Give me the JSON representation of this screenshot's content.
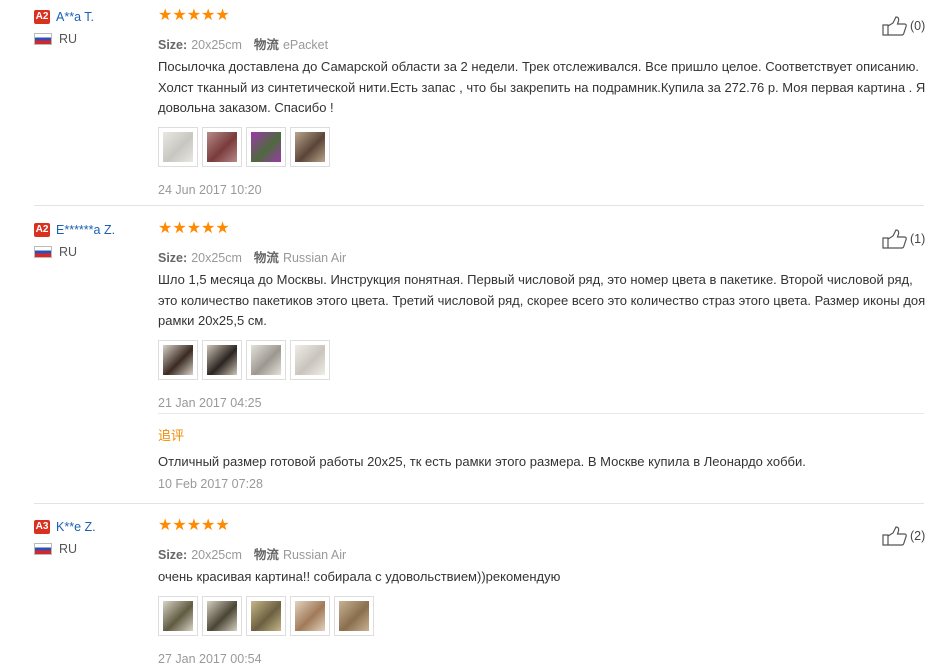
{
  "reviews": [
    {
      "badge": "A2",
      "name": "A**a T.",
      "country": "RU",
      "stars": "★★★★★",
      "size_label": "Size:",
      "size_value": "20x25cm",
      "ship_label": "物流",
      "ship_value": "ePacket",
      "text": "Посылочка доставлена до Самарской области за 2 недели. Трек отслеживался. Все пришло целое. Соответствует описанию. Холст тканный из синтетической нити.Есть запас , что бы закрепить на подрамник.Купила за 272.76 р. Моя первая картина . Я довольна заказом. Спасибо !",
      "date": "24 Jun 2017 10:20",
      "helpful": "(0)",
      "thumb_colors": [
        [
          "#c8c6c0",
          "#e9e7e2"
        ],
        [
          "#7a3b3b",
          "#b58a8a"
        ],
        [
          "#4e6a3e",
          "#9b3aa8"
        ],
        [
          "#5a4438",
          "#b9a58c"
        ]
      ]
    },
    {
      "badge": "A2",
      "name": "E******a Z.",
      "country": "RU",
      "stars": "★★★★★",
      "size_label": "Size:",
      "size_value": "20x25cm",
      "ship_label": "物流",
      "ship_value": "Russian Air",
      "text": "Шло 1,5 месяца до Москвы. Инструкция понятная. Первый числовой ряд, это номер цвета в пакетике. Второй числовой ряд, это количество пакетиков этого цвета. Третий числовой ряд, скорее всего это количество страз этого цвета. Размер иконы доя рамки 20x25,5 см.",
      "date": "21 Jan 2017 04:25",
      "helpful": "(1)",
      "append_title": "追评",
      "append_text": "Отличный размер готовой работы 20x25, тк есть рамки этого размера. В Москве купила в Леонардо хобби.",
      "append_date": "10 Feb 2017 07:28",
      "thumb_colors": [
        [
          "#3a2a22",
          "#d8d2c8"
        ],
        [
          "#2b2420",
          "#cfc6b8"
        ],
        [
          "#9c9890",
          "#e4e1dc"
        ],
        [
          "#c9c4bc",
          "#efece8"
        ]
      ]
    },
    {
      "badge": "A3",
      "name": "K**e Z.",
      "country": "RU",
      "stars": "★★★★★",
      "size_label": "Size:",
      "size_value": "20x25cm",
      "ship_label": "物流",
      "ship_value": "Russian Air",
      "text": "очень красивая картина!! собирала с удовольствием))рекомендую",
      "date": "27 Jan 2017 00:54",
      "helpful": "(2)",
      "thumb_colors": [
        [
          "#5f5a40",
          "#d9d4c6"
        ],
        [
          "#4a4534",
          "#d6d0c0"
        ],
        [
          "#6b6040",
          "#c8b68a"
        ],
        [
          "#a07a58",
          "#e3d3bf"
        ],
        [
          "#8a6e4e",
          "#c7b394"
        ]
      ]
    }
  ]
}
